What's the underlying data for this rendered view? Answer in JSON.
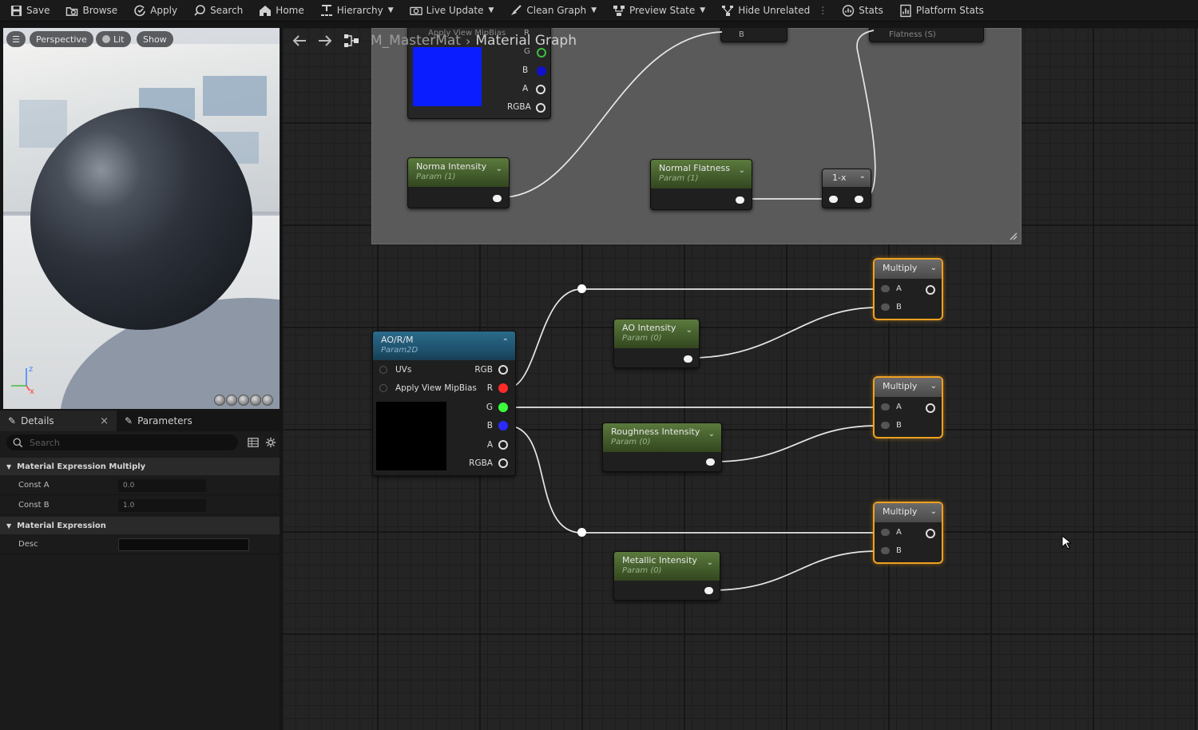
{
  "toolbar": {
    "items": [
      {
        "label": "Save",
        "icon": "save-icon"
      },
      {
        "label": "Browse",
        "icon": "browse-icon"
      },
      {
        "label": "Apply",
        "icon": "apply-icon"
      },
      {
        "label": "Search",
        "icon": "search-icon"
      },
      {
        "label": "Home",
        "icon": "home-icon"
      },
      {
        "label": "Hierarchy",
        "icon": "hierarchy-icon"
      },
      {
        "label": "Live Update",
        "icon": "live-update-icon"
      },
      {
        "label": "Clean Graph",
        "icon": "clean-graph-icon"
      },
      {
        "label": "Preview State",
        "icon": "preview-state-icon"
      },
      {
        "label": "Hide Unrelated",
        "icon": "hide-unrelated-icon"
      },
      {
        "label": "Stats",
        "icon": "stats-icon"
      },
      {
        "label": "Platform Stats",
        "icon": "platform-stats-icon"
      }
    ]
  },
  "viewport": {
    "perspective": "Perspective",
    "lit": "Lit",
    "show": "Show",
    "axis_z": "z",
    "axis_x": "x"
  },
  "details": {
    "tab_details": "Details",
    "tab_parameters": "Parameters",
    "search_placeholder": "Search",
    "section1": "Material Expression Multiply",
    "const_a_label": "Const A",
    "const_a_value": "0.0",
    "const_b_label": "Const B",
    "const_b_value": "1.0",
    "section2": "Material Expression",
    "desc_label": "Desc",
    "desc_value": ""
  },
  "graph": {
    "breadcrumb_root": "M_MasterMat",
    "breadcrumb_current": "Material Graph",
    "top_partial_node": "B",
    "top_partial_node2": "Flatness (S)",
    "partial_mipbias": "Apply View MipBias",
    "partial_r": "R",
    "partial_g": "G",
    "partial_b": "B",
    "partial_a": "A",
    "partial_rgba": "RGBA",
    "swatch_color": "#0a1dff",
    "norma_intensity": {
      "title": "Norma Intensity",
      "sub": "Param (1)"
    },
    "normal_flatness": {
      "title": "Normal Flatness",
      "sub": "Param (1)"
    },
    "one_minus": "1-x",
    "aorm": {
      "title": "AO/R/M",
      "sub": "Param2D",
      "in_uvs": "UVs",
      "in_mip": "Apply View MipBias",
      "out_rgb": "RGB",
      "out_r": "R",
      "out_g": "G",
      "out_b": "B",
      "out_a": "A",
      "out_rgba": "RGBA"
    },
    "ao_intensity": {
      "title": "AO Intensity",
      "sub": "Param (0)"
    },
    "roughness_intensity": {
      "title": "Roughness Intensity",
      "sub": "Param (0)"
    },
    "metallic_intensity": {
      "title": "Metallic Intensity",
      "sub": "Param (0)"
    },
    "multiply": {
      "title": "Multiply",
      "a": "A",
      "b": "B"
    },
    "colors": {
      "accent": "#f0a020",
      "red_pin": "#ff2a2a",
      "green_pin": "#3cff3c",
      "blue_pin": "#2a2aff"
    }
  }
}
